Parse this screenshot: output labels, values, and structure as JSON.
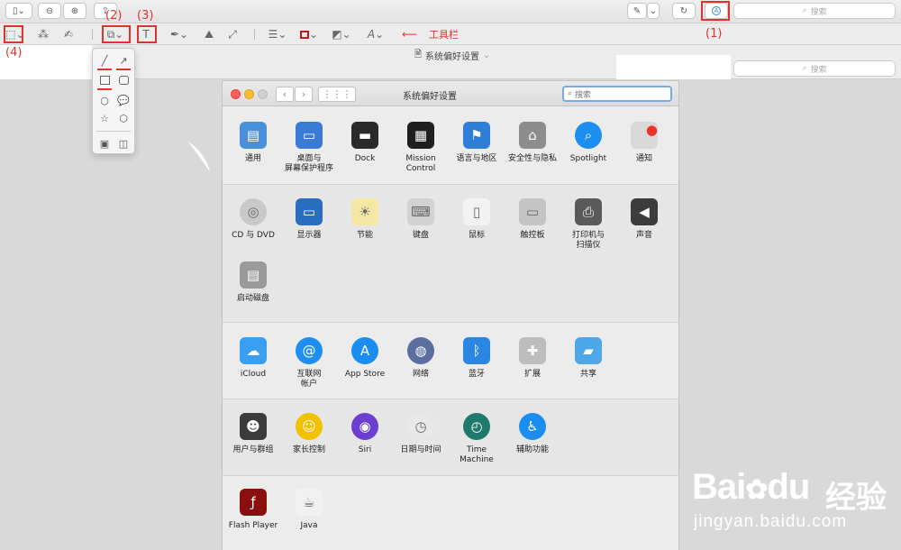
{
  "toolbar": {
    "search_placeholder": "搜索",
    "annotation_label": "工具栏",
    "markers": {
      "m1": "(1)",
      "m2": "(2)",
      "m3": "(3)",
      "m4": "(4)"
    }
  },
  "document": {
    "title": "系统偏好设置",
    "search_placeholder": "搜索"
  },
  "prefs_window": {
    "title": "系统偏好设置",
    "search_value": "搜索",
    "rows": [
      [
        {
          "label": "通用",
          "icon": "general-icon",
          "color": "#4a90d9"
        },
        {
          "label": "桌面与\n屏幕保护程序",
          "icon": "desktop-icon",
          "color": "#3a7bd5"
        },
        {
          "label": "Dock",
          "icon": "dock-icon",
          "color": "#2b2b2b"
        },
        {
          "label": "Mission\nControl",
          "icon": "mission-control-icon",
          "color": "#1f1f1f"
        },
        {
          "label": "语言与地区",
          "icon": "flag-icon",
          "color": "#2f7fd8"
        },
        {
          "label": "安全性与隐私",
          "icon": "house-icon",
          "color": "#8d8d8d"
        },
        {
          "label": "Spotlight",
          "icon": "spotlight-icon",
          "color": "#1d8ff0"
        },
        {
          "label": "通知",
          "icon": "notification-icon",
          "color": "#d9d9d9"
        }
      ],
      [
        {
          "label": "CD 与 DVD",
          "icon": "cd-icon",
          "color": "#c9c9c9"
        },
        {
          "label": "显示器",
          "icon": "display-icon",
          "color": "#2a6fbf"
        },
        {
          "label": "节能",
          "icon": "bulb-icon",
          "color": "#f3e7a3"
        },
        {
          "label": "键盘",
          "icon": "keyboard-icon",
          "color": "#d2d2d2"
        },
        {
          "label": "鼠标",
          "icon": "mouse-icon",
          "color": "#f2f2f2"
        },
        {
          "label": "触控板",
          "icon": "trackpad-icon",
          "color": "#c4c4c4"
        },
        {
          "label": "打印机与\n扫描仪",
          "icon": "printer-icon",
          "color": "#5a5a5a"
        },
        {
          "label": "声音",
          "icon": "speaker-icon",
          "color": "#3c3c3c"
        },
        {
          "label": "启动磁盘",
          "icon": "disk-icon",
          "color": "#9a9a9a"
        }
      ],
      [
        {
          "label": "iCloud",
          "icon": "cloud-icon",
          "color": "#3a9ff0"
        },
        {
          "label": "互联网\n帐户",
          "icon": "at-icon",
          "color": "#1e8ff0"
        },
        {
          "label": "App Store",
          "icon": "appstore-icon",
          "color": "#1a8ef0"
        },
        {
          "label": "网络",
          "icon": "globe-icon",
          "color": "#5a6fa0"
        },
        {
          "label": "蓝牙",
          "icon": "bluetooth-icon",
          "color": "#2a86e0"
        },
        {
          "label": "扩展",
          "icon": "puzzle-icon",
          "color": "#bdbdbd"
        },
        {
          "label": "共享",
          "icon": "folder-icon",
          "color": "#4ea7e8"
        }
      ],
      [
        {
          "label": "用户与群组",
          "icon": "users-icon",
          "color": "#3b3b3b"
        },
        {
          "label": "家长控制",
          "icon": "parental-icon",
          "color": "#f2c200"
        },
        {
          "label": "Siri",
          "icon": "siri-icon",
          "color": "#6d3fd1"
        },
        {
          "label": "日期与时间",
          "icon": "clock-icon",
          "color": "#e8e8e8"
        },
        {
          "label": "Time Machine",
          "icon": "timemachine-icon",
          "color": "#1f7a6b"
        },
        {
          "label": "辅助功能",
          "icon": "accessibility-icon",
          "color": "#1a8ef0"
        }
      ],
      [
        {
          "label": "Flash Player",
          "icon": "flash-icon",
          "color": "#8a1010"
        },
        {
          "label": "Java",
          "icon": "java-icon",
          "color": "#f1f1f1"
        }
      ]
    ]
  },
  "watermark": {
    "brand": "Bai",
    "brand2": "du",
    "cn": "经验",
    "url": "jingyan.baidu.com"
  },
  "colors": {
    "accent_red": "#e5312b",
    "focus_blue": "#7ba9e6"
  }
}
